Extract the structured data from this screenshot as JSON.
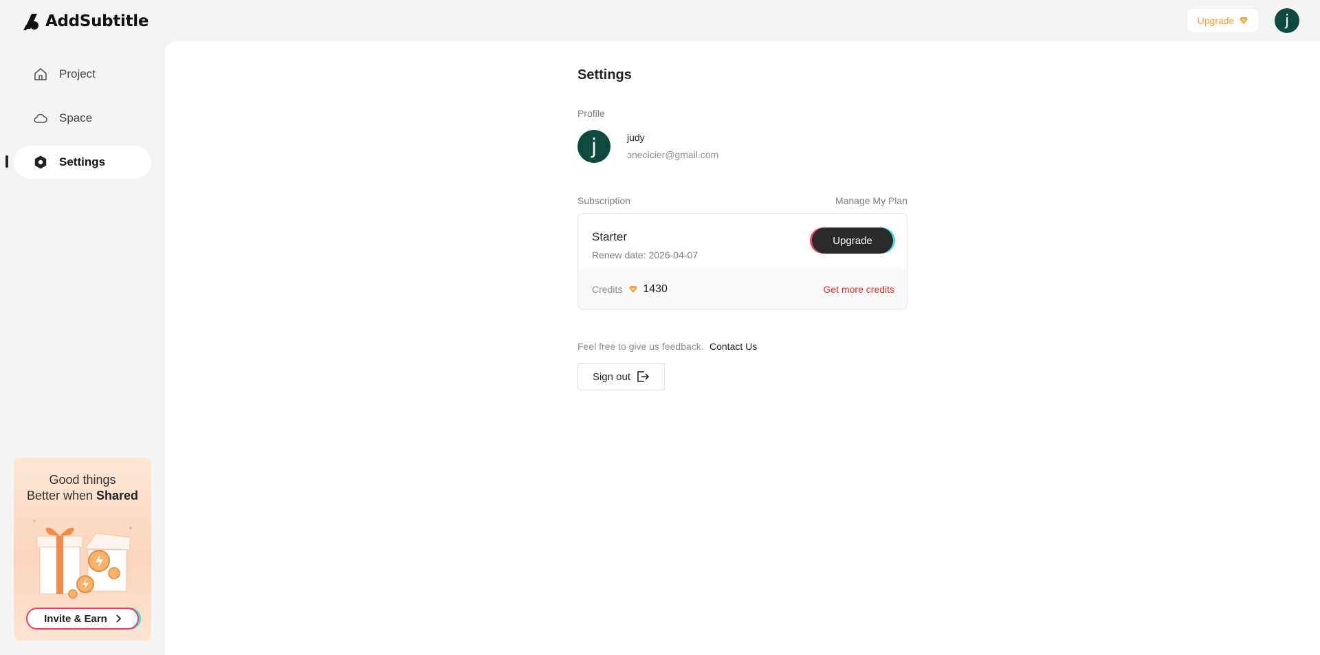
{
  "app": {
    "name": "AddSubtitle"
  },
  "header": {
    "upgrade_label": "Upgrade",
    "avatar_initial": "j"
  },
  "sidebar": {
    "items": [
      {
        "label": "Project",
        "icon": "home-icon",
        "active": false
      },
      {
        "label": "Space",
        "icon": "cloud-icon",
        "active": false
      },
      {
        "label": "Settings",
        "icon": "settings-icon",
        "active": true
      }
    ],
    "promo": {
      "line1": "Good things",
      "line2_prefix": "Better when ",
      "line2_bold": "Shared",
      "button_label": "Invite & Earn"
    }
  },
  "settings": {
    "title": "Settings",
    "profile": {
      "label": "Profile",
      "avatar_initial": "j",
      "name": "judy",
      "email": "ɔnecicier@gmail.com"
    },
    "subscription": {
      "label": "Subscription",
      "manage_label": "Manage My Plan",
      "plan_name": "Starter",
      "renew_text": "Renew date: 2026-04-07",
      "upgrade_label": "Upgrade",
      "credits_label": "Credits",
      "credits_value": "1430",
      "get_more_label": "Get more credits"
    },
    "feedback_text": "Feel free to give us feedback.",
    "contact_label": "Contact Us",
    "signout_label": "Sign out"
  },
  "colors": {
    "accent_orange": "#f0a23a",
    "avatar_green": "#0e4a3e",
    "link_red": "#e0322b",
    "brand_red": "#e8445a",
    "brand_cyan": "#4fd8e0"
  }
}
